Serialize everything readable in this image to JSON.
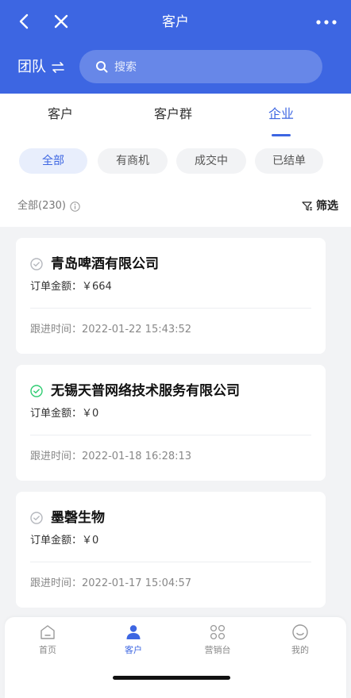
{
  "header": {
    "title": "客户",
    "team_label": "团队",
    "search_placeholder": "搜索",
    "bg_color": "#3d66e2"
  },
  "tabs": [
    {
      "label": "客户",
      "active": false
    },
    {
      "label": "客户群",
      "active": false
    },
    {
      "label": "企业",
      "active": true
    }
  ],
  "filters": [
    {
      "label": "全部",
      "active": true
    },
    {
      "label": "有商机",
      "active": false
    },
    {
      "label": "成交中",
      "active": false
    },
    {
      "label": "已结单",
      "active": false
    }
  ],
  "summary": {
    "count_text": "全部(230)",
    "filter_label": "筛选"
  },
  "companies": [
    {
      "name": "青岛啤酒有限公司",
      "amount": "订单金额：￥664",
      "follow_time": "跟进时间：2022-01-22 15:43:52",
      "verified": false
    },
    {
      "name": "无锡天普网络技术服务有限公司",
      "amount": "订单金额：￥0",
      "follow_time": "跟进时间：2022-01-18 16:28:13",
      "verified": true
    },
    {
      "name": "墨磬生物",
      "amount": "订单金额：￥0",
      "follow_time": "跟进时间：2022-01-17 15:04:57",
      "verified": false
    }
  ],
  "tabbar": [
    {
      "label": "首页",
      "icon": "home-icon",
      "active": false
    },
    {
      "label": "客户",
      "icon": "person-icon",
      "active": true
    },
    {
      "label": "营销台",
      "icon": "grid-icon",
      "active": false
    },
    {
      "label": "我的",
      "icon": "smile-icon",
      "active": false
    }
  ],
  "colors": {
    "accent": "#3d66e2",
    "verified": "#2ecc71",
    "unverified": "#b5b8be"
  }
}
